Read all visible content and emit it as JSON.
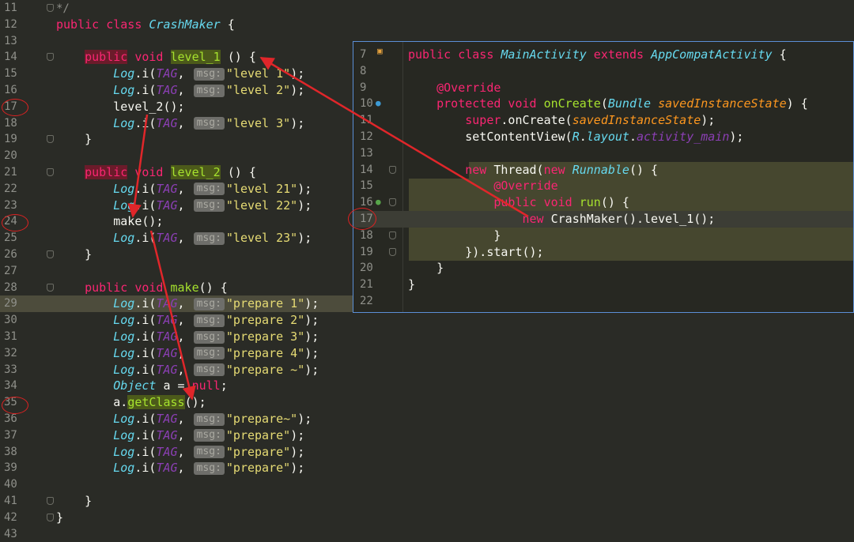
{
  "main_editor": {
    "lines": [
      {
        "n": "11",
        "code": [
          {
            "t": "*/",
            "c": "cmt"
          }
        ]
      },
      {
        "n": "12",
        "code": [
          {
            "t": "public class ",
            "c": "kw"
          },
          {
            "t": "CrashMaker",
            "c": "cls"
          },
          {
            "t": " {",
            "c": ""
          }
        ]
      },
      {
        "n": "13",
        "code": []
      },
      {
        "n": "14",
        "code": [
          {
            "t": "    ",
            "c": ""
          },
          {
            "t": "public",
            "c": "hl-kw"
          },
          {
            "t": " void ",
            "c": "kw"
          },
          {
            "t": "level_1",
            "c": "hl-fn"
          },
          {
            "t": " () {",
            "c": ""
          }
        ]
      },
      {
        "n": "15",
        "code": [
          {
            "t": "        ",
            "c": ""
          },
          {
            "t": "Log",
            "c": "logi"
          },
          {
            "t": ".i(",
            "c": ""
          },
          {
            "t": "TAG",
            "c": "tag"
          },
          {
            "t": ", ",
            "c": ""
          },
          {
            "t": "msg:",
            "c": "hint"
          },
          {
            "t": "\"level 1\"",
            "c": "str"
          },
          {
            "t": ");",
            "c": ""
          }
        ]
      },
      {
        "n": "16",
        "code": [
          {
            "t": "        ",
            "c": ""
          },
          {
            "t": "Log",
            "c": "logi"
          },
          {
            "t": ".i(",
            "c": ""
          },
          {
            "t": "TAG",
            "c": "tag"
          },
          {
            "t": ", ",
            "c": ""
          },
          {
            "t": "msg:",
            "c": "hint"
          },
          {
            "t": "\"level 2\"",
            "c": "str"
          },
          {
            "t": ");",
            "c": ""
          }
        ]
      },
      {
        "n": "17",
        "code": [
          {
            "t": "        level_2();",
            "c": ""
          }
        ]
      },
      {
        "n": "18",
        "code": [
          {
            "t": "        ",
            "c": ""
          },
          {
            "t": "Log",
            "c": "logi"
          },
          {
            "t": ".i(",
            "c": ""
          },
          {
            "t": "TAG",
            "c": "tag"
          },
          {
            "t": ", ",
            "c": ""
          },
          {
            "t": "msg:",
            "c": "hint"
          },
          {
            "t": "\"level 3\"",
            "c": "str"
          },
          {
            "t": ");",
            "c": ""
          }
        ]
      },
      {
        "n": "19",
        "code": [
          {
            "t": "    }",
            "c": ""
          }
        ]
      },
      {
        "n": "20",
        "code": []
      },
      {
        "n": "21",
        "code": [
          {
            "t": "    ",
            "c": ""
          },
          {
            "t": "public",
            "c": "hl-kw"
          },
          {
            "t": " void ",
            "c": "kw"
          },
          {
            "t": "level_2",
            "c": "hl-fn"
          },
          {
            "t": " () {",
            "c": ""
          }
        ]
      },
      {
        "n": "22",
        "code": [
          {
            "t": "        ",
            "c": ""
          },
          {
            "t": "Log",
            "c": "logi"
          },
          {
            "t": ".i(",
            "c": ""
          },
          {
            "t": "TAG",
            "c": "tag"
          },
          {
            "t": ", ",
            "c": ""
          },
          {
            "t": "msg:",
            "c": "hint"
          },
          {
            "t": "\"level 21\"",
            "c": "str"
          },
          {
            "t": ");",
            "c": ""
          }
        ]
      },
      {
        "n": "23",
        "code": [
          {
            "t": "        ",
            "c": ""
          },
          {
            "t": "Log",
            "c": "logi"
          },
          {
            "t": ".i(",
            "c": ""
          },
          {
            "t": "TAG",
            "c": "tag"
          },
          {
            "t": ", ",
            "c": ""
          },
          {
            "t": "msg:",
            "c": "hint"
          },
          {
            "t": "\"level 22\"",
            "c": "str"
          },
          {
            "t": ");",
            "c": ""
          }
        ]
      },
      {
        "n": "24",
        "code": [
          {
            "t": "        make();",
            "c": ""
          }
        ]
      },
      {
        "n": "25",
        "code": [
          {
            "t": "        ",
            "c": ""
          },
          {
            "t": "Log",
            "c": "logi"
          },
          {
            "t": ".i(",
            "c": ""
          },
          {
            "t": "TAG",
            "c": "tag"
          },
          {
            "t": ", ",
            "c": ""
          },
          {
            "t": "msg:",
            "c": "hint"
          },
          {
            "t": "\"level 23\"",
            "c": "str"
          },
          {
            "t": ");",
            "c": ""
          }
        ]
      },
      {
        "n": "26",
        "code": [
          {
            "t": "    }",
            "c": ""
          }
        ]
      },
      {
        "n": "27",
        "code": []
      },
      {
        "n": "28",
        "code": [
          {
            "t": "    ",
            "c": ""
          },
          {
            "t": "public void ",
            "c": "kw"
          },
          {
            "t": "make",
            "c": "fn"
          },
          {
            "t": "() {",
            "c": ""
          }
        ]
      },
      {
        "n": "29",
        "code": [
          {
            "t": "        ",
            "c": ""
          },
          {
            "t": "Log",
            "c": "logi"
          },
          {
            "t": ".i(",
            "c": ""
          },
          {
            "t": "TAG",
            "c": "tag"
          },
          {
            "t": ", ",
            "c": ""
          },
          {
            "t": "msg:",
            "c": "hint"
          },
          {
            "t": "\"prepare 1\"",
            "c": "str"
          },
          {
            "t": ");",
            "c": ""
          }
        ],
        "highlight": true
      },
      {
        "n": "30",
        "code": [
          {
            "t": "        ",
            "c": ""
          },
          {
            "t": "Log",
            "c": "logi"
          },
          {
            "t": ".i(",
            "c": ""
          },
          {
            "t": "TAG",
            "c": "tag"
          },
          {
            "t": ", ",
            "c": ""
          },
          {
            "t": "msg:",
            "c": "hint"
          },
          {
            "t": "\"prepare 2\"",
            "c": "str"
          },
          {
            "t": ");",
            "c": ""
          }
        ]
      },
      {
        "n": "31",
        "code": [
          {
            "t": "        ",
            "c": ""
          },
          {
            "t": "Log",
            "c": "logi"
          },
          {
            "t": ".i(",
            "c": ""
          },
          {
            "t": "TAG",
            "c": "tag"
          },
          {
            "t": ", ",
            "c": ""
          },
          {
            "t": "msg:",
            "c": "hint"
          },
          {
            "t": "\"prepare 3\"",
            "c": "str"
          },
          {
            "t": ");",
            "c": ""
          }
        ]
      },
      {
        "n": "32",
        "code": [
          {
            "t": "        ",
            "c": ""
          },
          {
            "t": "Log",
            "c": "logi"
          },
          {
            "t": ".i(",
            "c": ""
          },
          {
            "t": "TAG",
            "c": "tag"
          },
          {
            "t": ", ",
            "c": ""
          },
          {
            "t": "msg:",
            "c": "hint"
          },
          {
            "t": "\"prepare 4\"",
            "c": "str"
          },
          {
            "t": ");",
            "c": ""
          }
        ]
      },
      {
        "n": "33",
        "code": [
          {
            "t": "        ",
            "c": ""
          },
          {
            "t": "Log",
            "c": "logi"
          },
          {
            "t": ".i(",
            "c": ""
          },
          {
            "t": "TAG",
            "c": "tag"
          },
          {
            "t": ", ",
            "c": ""
          },
          {
            "t": "msg:",
            "c": "hint"
          },
          {
            "t": "\"prepare ~\"",
            "c": "str"
          },
          {
            "t": ");",
            "c": ""
          }
        ]
      },
      {
        "n": "34",
        "code": [
          {
            "t": "        ",
            "c": ""
          },
          {
            "t": "Object",
            "c": "cls"
          },
          {
            "t": " a = ",
            "c": ""
          },
          {
            "t": "null",
            "c": "kw"
          },
          {
            "t": ";",
            "c": ""
          }
        ]
      },
      {
        "n": "35",
        "code": [
          {
            "t": "        a.",
            "c": ""
          },
          {
            "t": "getClass",
            "c": "hl-fn"
          },
          {
            "t": "();",
            "c": ""
          }
        ]
      },
      {
        "n": "36",
        "code": [
          {
            "t": "        ",
            "c": ""
          },
          {
            "t": "Log",
            "c": "logi"
          },
          {
            "t": ".i(",
            "c": ""
          },
          {
            "t": "TAG",
            "c": "tag"
          },
          {
            "t": ", ",
            "c": ""
          },
          {
            "t": "msg:",
            "c": "hint"
          },
          {
            "t": "\"prepare~\"",
            "c": "str"
          },
          {
            "t": ");",
            "c": ""
          }
        ]
      },
      {
        "n": "37",
        "code": [
          {
            "t": "        ",
            "c": ""
          },
          {
            "t": "Log",
            "c": "logi"
          },
          {
            "t": ".i(",
            "c": ""
          },
          {
            "t": "TAG",
            "c": "tag"
          },
          {
            "t": ", ",
            "c": ""
          },
          {
            "t": "msg:",
            "c": "hint"
          },
          {
            "t": "\"prepare\"",
            "c": "str"
          },
          {
            "t": ");",
            "c": ""
          }
        ]
      },
      {
        "n": "38",
        "code": [
          {
            "t": "        ",
            "c": ""
          },
          {
            "t": "Log",
            "c": "logi"
          },
          {
            "t": ".i(",
            "c": ""
          },
          {
            "t": "TAG",
            "c": "tag"
          },
          {
            "t": ", ",
            "c": ""
          },
          {
            "t": "msg:",
            "c": "hint"
          },
          {
            "t": "\"prepare\"",
            "c": "str"
          },
          {
            "t": ");",
            "c": ""
          }
        ]
      },
      {
        "n": "39",
        "code": [
          {
            "t": "        ",
            "c": ""
          },
          {
            "t": "Log",
            "c": "logi"
          },
          {
            "t": ".i(",
            "c": ""
          },
          {
            "t": "TAG",
            "c": "tag"
          },
          {
            "t": ", ",
            "c": ""
          },
          {
            "t": "msg:",
            "c": "hint"
          },
          {
            "t": "\"prepare\"",
            "c": "str"
          },
          {
            "t": ");",
            "c": ""
          }
        ]
      },
      {
        "n": "40",
        "code": []
      },
      {
        "n": "41",
        "code": [
          {
            "t": "    }",
            "c": ""
          }
        ]
      },
      {
        "n": "42",
        "code": [
          {
            "t": "}",
            "c": ""
          }
        ]
      },
      {
        "n": "43",
        "code": []
      }
    ]
  },
  "popup_editor": {
    "lines": [
      {
        "n": "7",
        "code": [
          {
            "t": "public class ",
            "c": "kw"
          },
          {
            "t": "MainActivity",
            "c": "cls"
          },
          {
            "t": " extends ",
            "c": "kw"
          },
          {
            "t": "AppCompatActivity",
            "c": "cls"
          },
          {
            "t": " {",
            "c": ""
          }
        ]
      },
      {
        "n": "8",
        "code": []
      },
      {
        "n": "9",
        "code": [
          {
            "t": "    ",
            "c": ""
          },
          {
            "t": "@Override",
            "c": "ann"
          }
        ]
      },
      {
        "n": "10",
        "code": [
          {
            "t": "    ",
            "c": ""
          },
          {
            "t": "protected void ",
            "c": "kw"
          },
          {
            "t": "onCreate",
            "c": "fn"
          },
          {
            "t": "(",
            "c": ""
          },
          {
            "t": "Bundle",
            "c": "cls"
          },
          {
            "t": " ",
            "c": ""
          },
          {
            "t": "savedInstanceState",
            "c": "param"
          },
          {
            "t": ") {",
            "c": ""
          }
        ]
      },
      {
        "n": "11",
        "code": [
          {
            "t": "        ",
            "c": ""
          },
          {
            "t": "super",
            "c": "kw"
          },
          {
            "t": ".onCreate(",
            "c": ""
          },
          {
            "t": "savedInstanceState",
            "c": "param"
          },
          {
            "t": ");",
            "c": ""
          }
        ]
      },
      {
        "n": "12",
        "code": [
          {
            "t": "        setContentView(",
            "c": ""
          },
          {
            "t": "R",
            "c": "cls"
          },
          {
            "t": ".",
            "c": ""
          },
          {
            "t": "layout",
            "c": "cls"
          },
          {
            "t": ".",
            "c": ""
          },
          {
            "t": "activity_main",
            "c": "tag"
          },
          {
            "t": ");",
            "c": ""
          }
        ]
      },
      {
        "n": "13",
        "code": []
      },
      {
        "n": "14",
        "code": [
          {
            "t": "        ",
            "c": ""
          },
          {
            "t": "new ",
            "c": "kw"
          },
          {
            "t": "Thread(",
            "c": ""
          },
          {
            "t": "new ",
            "c": "kw"
          },
          {
            "t": "Runnable",
            "c": "cls"
          },
          {
            "t": "() {",
            "c": ""
          }
        ]
      },
      {
        "n": "15",
        "code": [
          {
            "t": "            ",
            "c": ""
          },
          {
            "t": "@Override",
            "c": "ann"
          }
        ]
      },
      {
        "n": "16",
        "code": [
          {
            "t": "            ",
            "c": ""
          },
          {
            "t": "public void ",
            "c": "kw"
          },
          {
            "t": "run",
            "c": "fn"
          },
          {
            "t": "() {",
            "c": ""
          }
        ]
      },
      {
        "n": "17",
        "code": [
          {
            "t": "                ",
            "c": ""
          },
          {
            "t": "new ",
            "c": "kw"
          },
          {
            "t": "CrashMaker().level_1();",
            "c": ""
          }
        ]
      },
      {
        "n": "18",
        "code": [
          {
            "t": "            }",
            "c": ""
          }
        ]
      },
      {
        "n": "19",
        "code": [
          {
            "t": "        }).start();",
            "c": ""
          }
        ]
      },
      {
        "n": "20",
        "code": [
          {
            "t": "    }",
            "c": ""
          }
        ]
      },
      {
        "n": "21",
        "code": [
          {
            "t": "}",
            "c": ""
          }
        ]
      },
      {
        "n": "22",
        "code": []
      }
    ]
  },
  "colors": {
    "arrow": "#e0262a",
    "accent_border": "#5b8fd6"
  }
}
